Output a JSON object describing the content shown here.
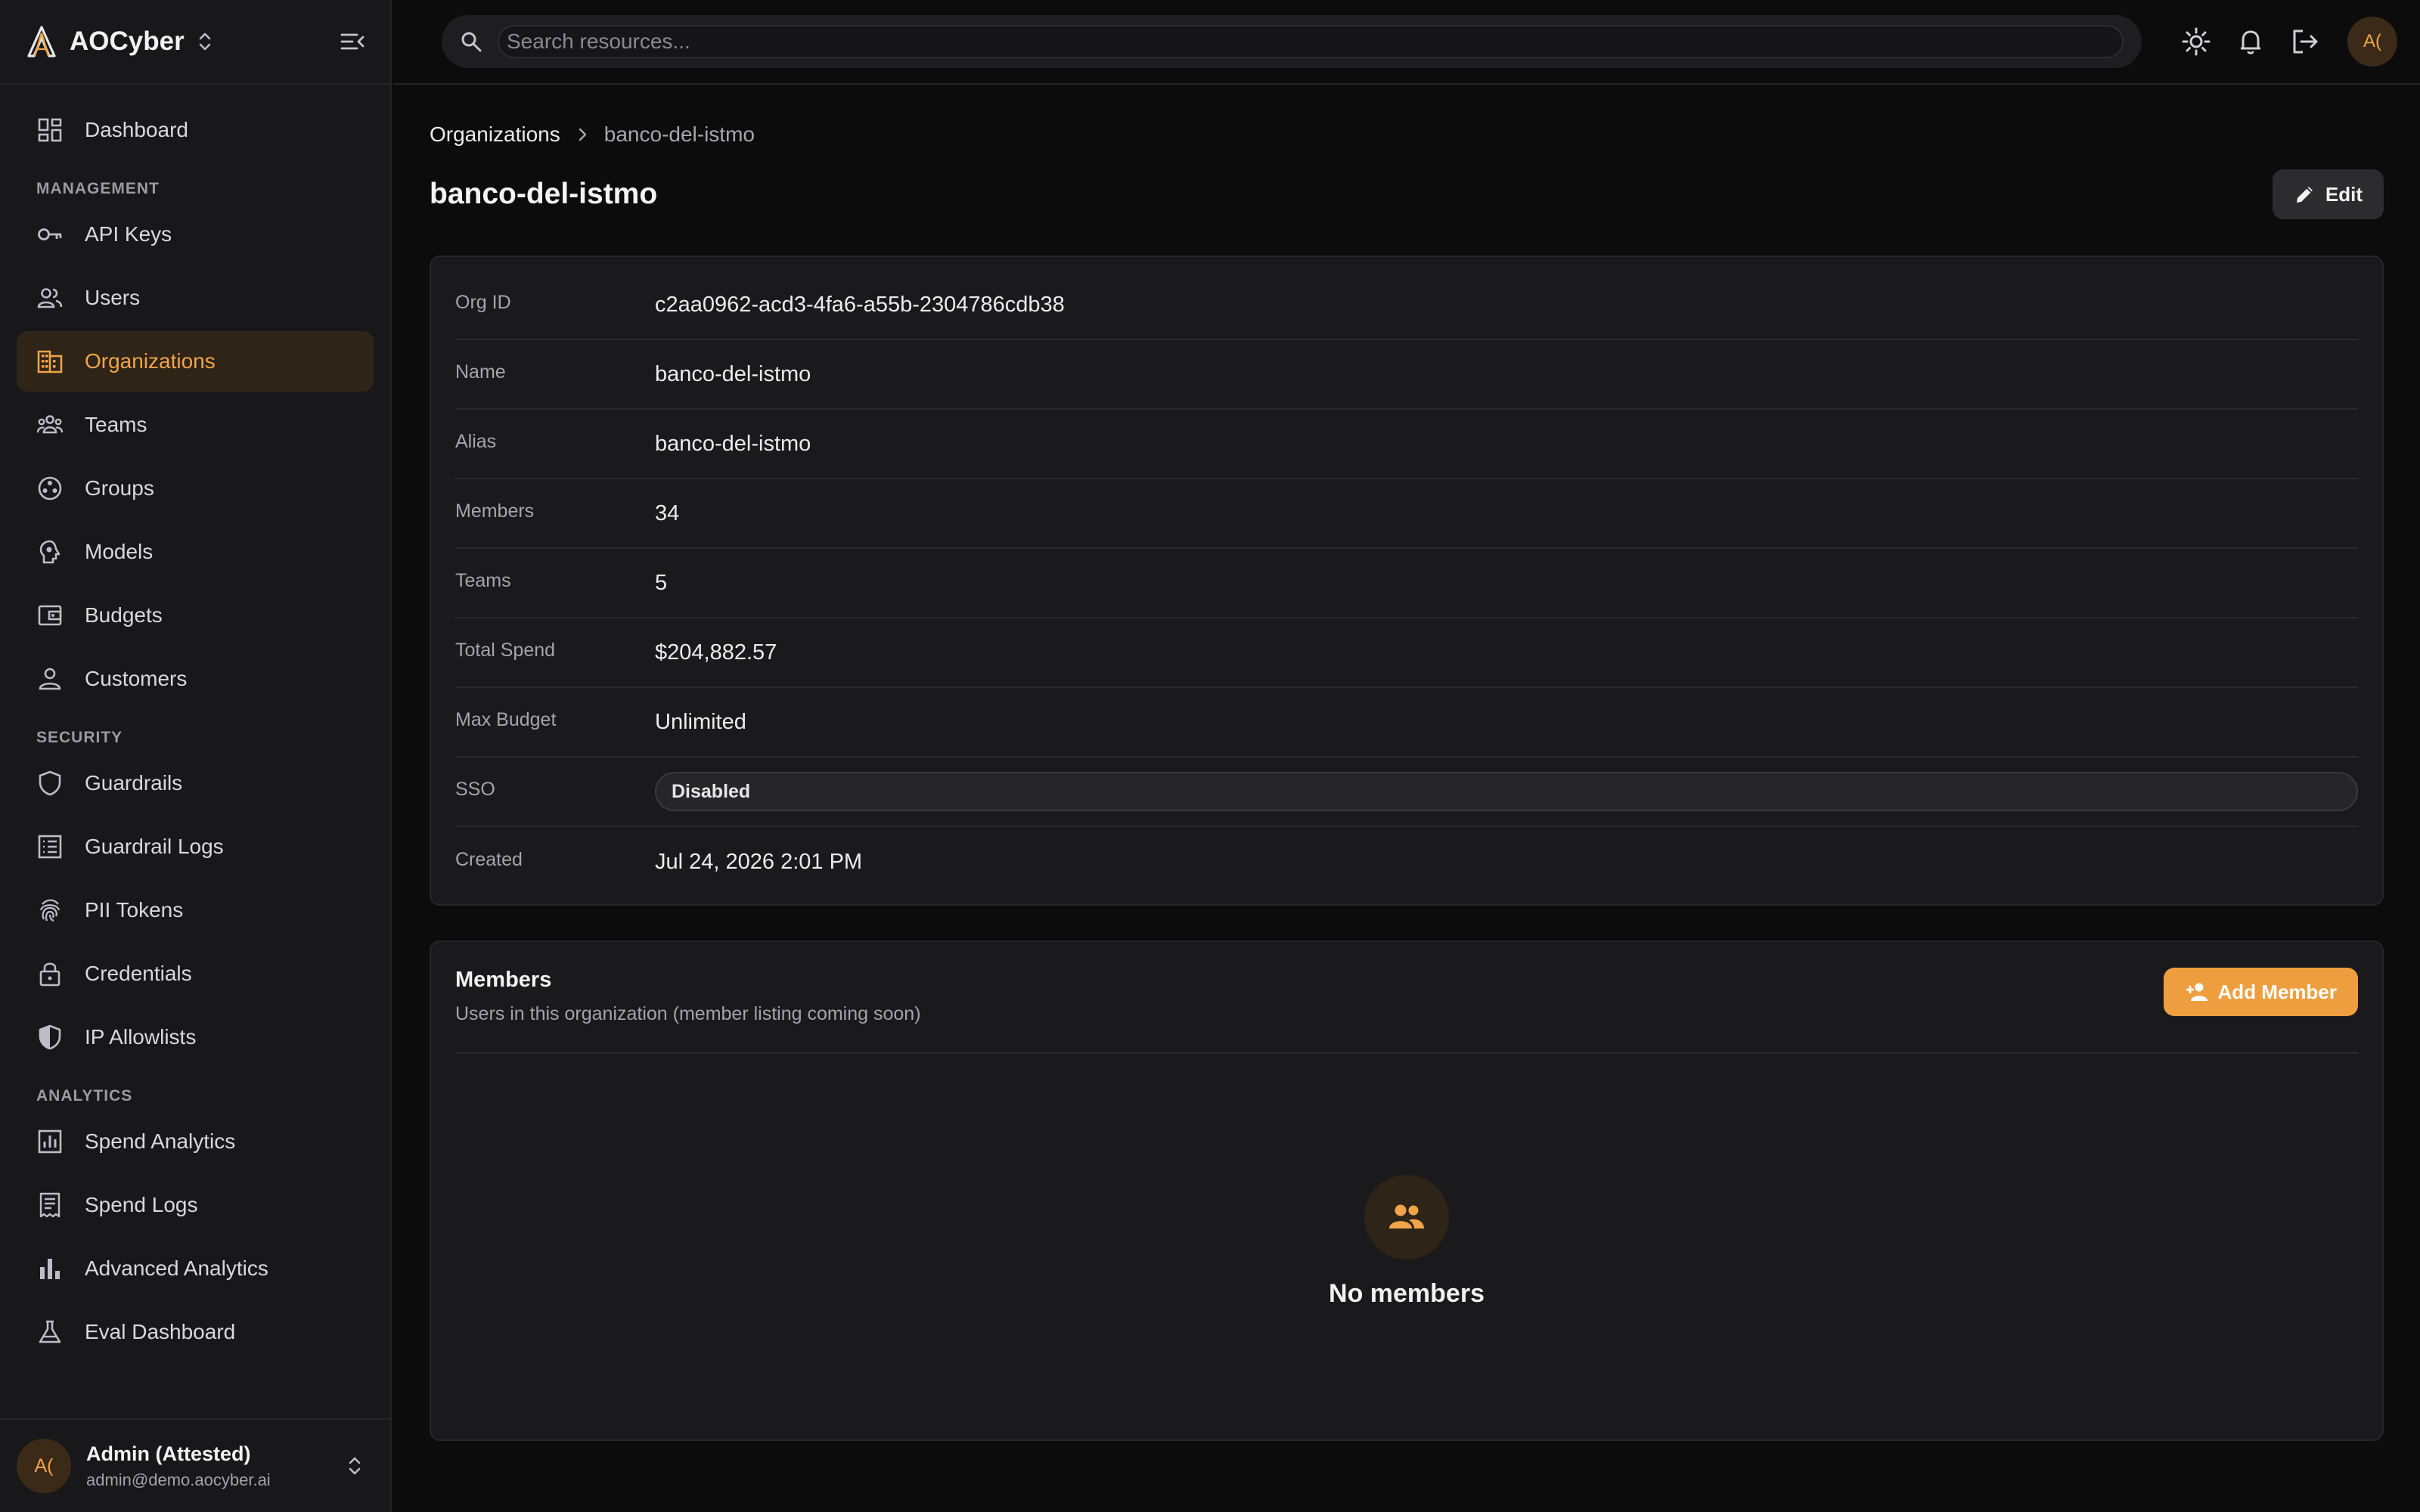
{
  "app": {
    "name": "AOCyber",
    "accent": "#f0a449"
  },
  "sidebar": {
    "top_items": [
      {
        "label": "Dashboard",
        "icon": "dashboard-icon"
      }
    ],
    "sections": [
      {
        "title": "MANAGEMENT",
        "items": [
          {
            "label": "API Keys",
            "icon": "key-icon"
          },
          {
            "label": "Users",
            "icon": "users-icon"
          },
          {
            "label": "Organizations",
            "icon": "building-icon",
            "active": true
          },
          {
            "label": "Teams",
            "icon": "teams-icon"
          },
          {
            "label": "Groups",
            "icon": "groups-icon"
          },
          {
            "label": "Models",
            "icon": "model-icon"
          },
          {
            "label": "Budgets",
            "icon": "wallet-icon"
          },
          {
            "label": "Customers",
            "icon": "person-icon"
          }
        ]
      },
      {
        "title": "SECURITY",
        "items": [
          {
            "label": "Guardrails",
            "icon": "shield-icon"
          },
          {
            "label": "Guardrail Logs",
            "icon": "log-list-icon"
          },
          {
            "label": "PII Tokens",
            "icon": "fingerprint-icon"
          },
          {
            "label": "Credentials",
            "icon": "lock-icon"
          },
          {
            "label": "IP Allowlists",
            "icon": "shield-half-icon"
          }
        ]
      },
      {
        "title": "ANALYTICS",
        "items": [
          {
            "label": "Spend Analytics",
            "icon": "analytics-icon"
          },
          {
            "label": "Spend Logs",
            "icon": "receipt-icon"
          },
          {
            "label": "Advanced Analytics",
            "icon": "bar-chart-icon"
          },
          {
            "label": "Eval Dashboard",
            "icon": "flask-icon"
          }
        ]
      }
    ],
    "user": {
      "initials": "A(",
      "name": "Admin (Attested)",
      "email": "admin@demo.aocyber.ai"
    }
  },
  "topbar": {
    "search_placeholder": "Search resources...",
    "avatar_initials": "A("
  },
  "breadcrumb": {
    "parent": "Organizations",
    "current": "banco-del-istmo"
  },
  "page": {
    "title": "banco-del-istmo",
    "edit_label": "Edit"
  },
  "details": [
    {
      "label": "Org ID",
      "value": "c2aa0962-acd3-4fa6-a55b-2304786cdb38"
    },
    {
      "label": "Name",
      "value": "banco-del-istmo"
    },
    {
      "label": "Alias",
      "value": "banco-del-istmo"
    },
    {
      "label": "Members",
      "value": "34"
    },
    {
      "label": "Teams",
      "value": "5"
    },
    {
      "label": "Total Spend",
      "value": "$204,882.57"
    },
    {
      "label": "Max Budget",
      "value": "Unlimited"
    },
    {
      "label": "SSO",
      "value": "Disabled",
      "badge": true
    },
    {
      "label": "Created",
      "value": "Jul 24, 2026 2:01 PM"
    }
  ],
  "members": {
    "title": "Members",
    "subtitle": "Users in this organization (member listing coming soon)",
    "add_label": "Add Member",
    "empty_text": "No members"
  }
}
